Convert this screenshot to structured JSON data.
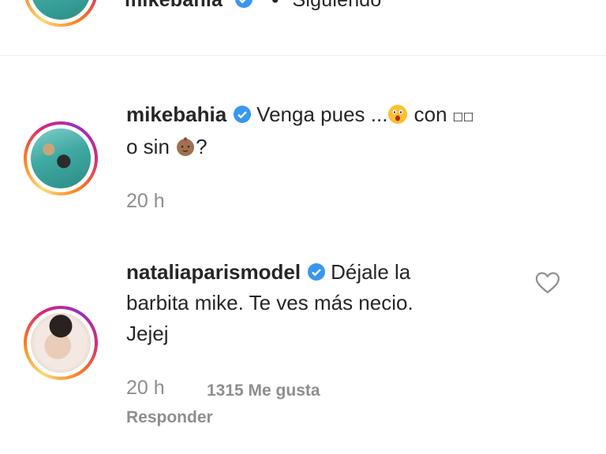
{
  "header": {
    "username": "mikebahia",
    "separator": "•",
    "following": "Siguiendo"
  },
  "comments": [
    {
      "username": "mikebahia",
      "text_line1": "Venga pues ...",
      "text_mid": " con ",
      "text_line2": "o sin ",
      "text_end": "?",
      "time": "20 h"
    },
    {
      "username": "nataliaparismodel",
      "text_line1": "Déjale la",
      "text_line2": "barbita mike. Te ves más necio.",
      "text_line3": "Jejej",
      "time": "20 h",
      "likes": "1315 Me gusta",
      "reply_label": "Responder"
    }
  ],
  "colors": {
    "verified": "#3897f0",
    "muted": "#8e8e8e",
    "text": "#262626"
  },
  "icons": [
    "verified-badge-icon",
    "heart-icon",
    "astonished-face-emoji",
    "baby-emoji"
  ]
}
